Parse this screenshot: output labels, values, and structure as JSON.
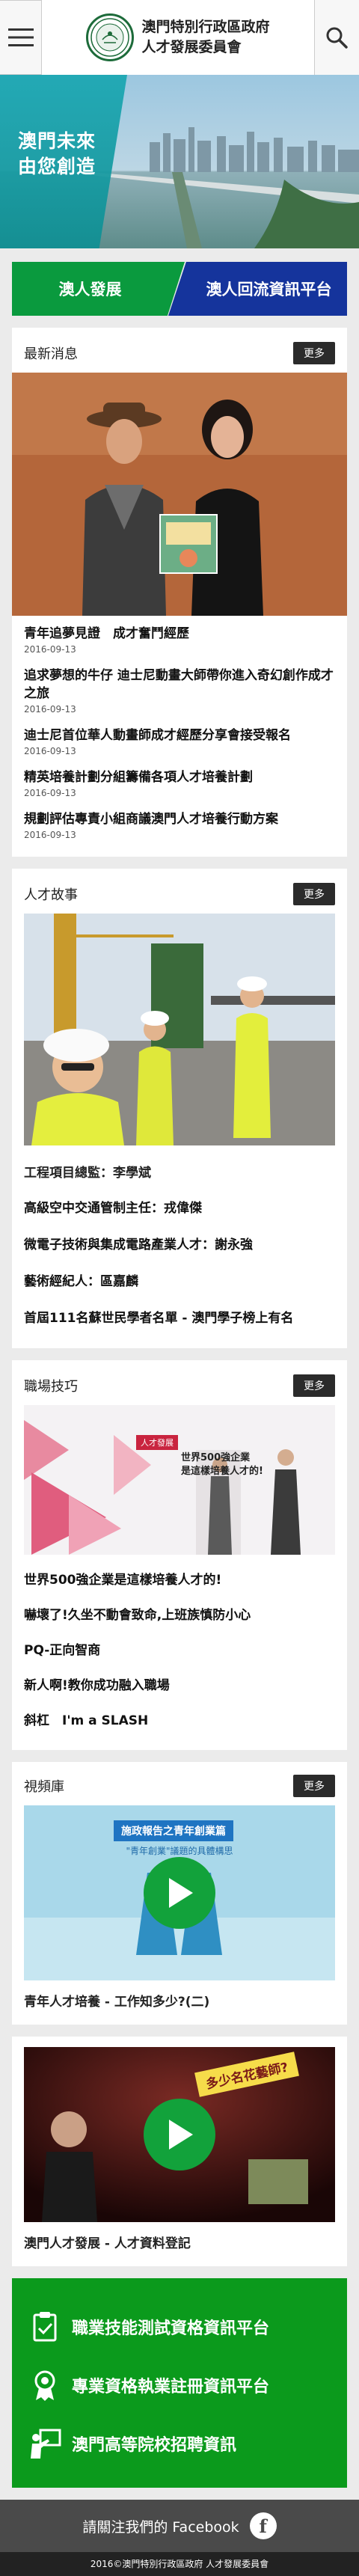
{
  "header": {
    "line1": "澳門特別行政區政府",
    "line2": "人才發展委員會"
  },
  "hero": {
    "slogan_line1": "澳門未來",
    "slogan_line2": "由您創造"
  },
  "tabs": [
    {
      "label": "澳人發展"
    },
    {
      "label": "澳人回流資訊平台"
    }
  ],
  "more_label": "更多",
  "latest_news": {
    "title": "最新消息",
    "items": [
      {
        "title": "青年追夢見證　成才奮鬥經歷",
        "date": "2016-09-13"
      },
      {
        "title": "追求夢想的牛仔 迪士尼動畫大師帶你進入奇幻創作成才之旅",
        "date": "2016-09-13"
      },
      {
        "title": "迪士尼首位華人動畫師成才經歷分享會接受報名",
        "date": "2016-09-13"
      },
      {
        "title": "精英培養計劃分組籌備各項人才培養計劃",
        "date": "2016-09-13"
      },
      {
        "title": "規劃評估專責小組商議澳門人才培養行動方案",
        "date": "2016-09-13"
      }
    ]
  },
  "talent_stories": {
    "title": "人才故事",
    "lead": "工程項目總監：李學斌",
    "items": [
      "高級空中交通管制主任：戎偉傑",
      "微電子技術與集成電路產業人才：謝永強",
      "藝術經紀人：區嘉麟",
      "首屆111名蘇世民學者名單 - 澳門學子榜上有名"
    ]
  },
  "workplace_skills": {
    "title": "職場技巧",
    "image_tag": "人才發展",
    "image_caption_line1": "世界500強企業",
    "image_caption_line2": "是這樣培養人才的!",
    "lead": "世界500強企業是這樣培養人才的!",
    "items": [
      "嚇壞了!久坐不動會致命,上班族慎防小心",
      "PQ-正向智商",
      "新人啊!教你成功融入職場",
      "斜杠　I'm a SLASH"
    ]
  },
  "video_library": {
    "title": "視頻庫",
    "videos": [
      {
        "banner": "施政報告之青年創業篇",
        "subtitle": "\"青年創業\"議題的具體構思",
        "title": "青年人才培養 - 工作知多少?(二)"
      },
      {
        "banner": "多少名花藝師?",
        "title": "澳門人才發展 - 人才資料登記"
      }
    ]
  },
  "info_links": [
    {
      "label": "職業技能測試資格資訊平台",
      "icon": "clipboard-check-icon"
    },
    {
      "label": "專業資格執業註冊資訊平台",
      "icon": "award-ribbon-icon"
    },
    {
      "label": "澳門高等院校招聘資訊",
      "icon": "lecturer-board-icon"
    }
  ],
  "facebook": {
    "label": "請關注我們的 Facebook"
  },
  "copyright": "2016©澳門特別行政區政府 人才發展委員會",
  "colors": {
    "green": "#0a9a3e",
    "blue": "#15349c",
    "teal": "#1aa7b2",
    "dark": "#2b2b2b"
  }
}
